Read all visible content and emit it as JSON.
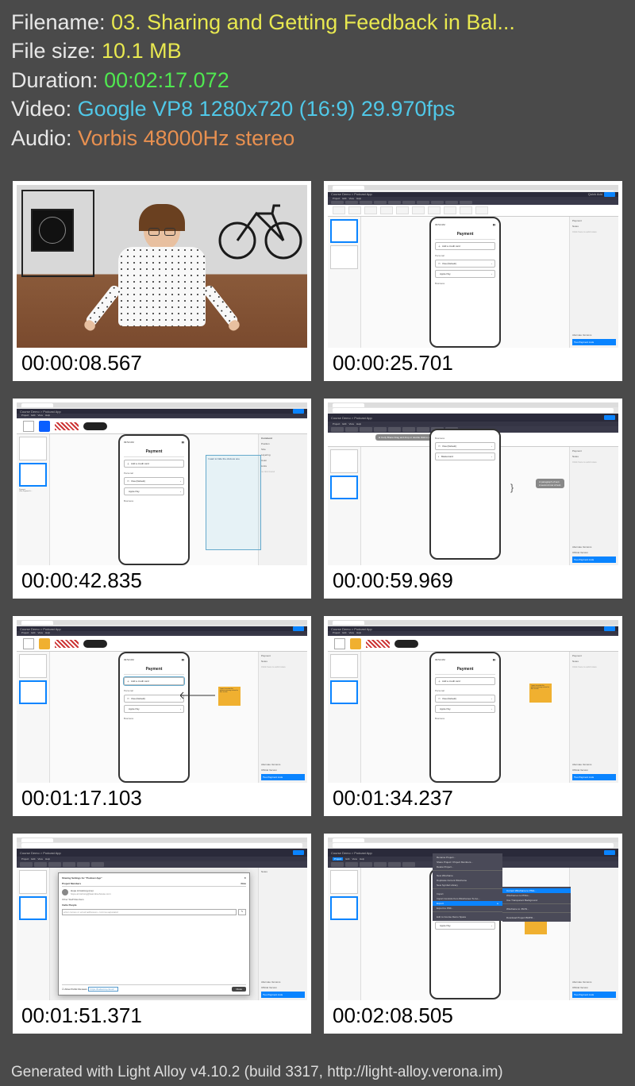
{
  "info": {
    "filename_label": "Filename: ",
    "filename_value": "03. Sharing and Getting Feedback in Bal...",
    "filesize_label": "File size: ",
    "filesize_value": "10.1 MB",
    "duration_label": "Duration: ",
    "duration_value": "00:02:17.072",
    "video_label": "Video: ",
    "video_value": "Google VP8 1280x720 (16:9) 29.970fps",
    "audio_label": "Audio: ",
    "audio_value": "Vorbis 48000Hz stereo"
  },
  "thumbs": {
    "t0": "00:00:08.567",
    "t1": "00:00:25.701",
    "t2": "00:00:42.835",
    "t3": "00:00:59.969",
    "t4": "00:01:17.103",
    "t5": "00:01:34.237",
    "t6": "00:01:51.371",
    "t7": "00:02:08.505"
  },
  "app": {
    "breadcrumb": "Course Demo > Podcast App",
    "menus": {
      "project": "Project",
      "edit": "Edit",
      "view": "View",
      "help": "Help"
    },
    "quickadd": "Quick Add",
    "share": "Share",
    "wireframes": "Wireframes",
    "phone": {
      "time": "09:52 AM",
      "title": "Payment",
      "add_card": "Add a credit card",
      "personal": "Personal",
      "visa": "Visa (Default)",
      "apple": "Apple Pay",
      "mastercard": "Mastercard",
      "business": "Business"
    },
    "right": {
      "payment": "Payment",
      "notes": "Notes",
      "notes_hint": "Click here to add notes",
      "altver": "Alternate Versions",
      "official": "Official Version",
      "twopay": "Two Payment Lists",
      "position": "Position",
      "size": "Size",
      "layering": "Layering",
      "color": "Color",
      "links": "Links",
      "nolink": "no link found"
    },
    "notes": {
      "comment1": "I want to hide the obvious one",
      "sticky1": "I want to make this obvious primary action for this screen",
      "callout1": "H Curly Brace\nDrag and drop or double click to add",
      "callout2": "A paragraph of text.\nA second row of text."
    },
    "dialog": {
      "title": "Sharing Settings for \"Podcast App\"",
      "members": "Project Members",
      "role": "Role",
      "name1": "Hope Armstrong (me)",
      "email1": "hope.armstrong@teamtreehouse.com",
      "other": "Other Staff Members",
      "invite": "Invite People",
      "placeholder": "enter names or email addresses, comma-separated",
      "allow": "Allow Public Reviews",
      "close": "Close"
    },
    "menu": {
      "rename": "Rename Project...",
      "shareproj": "Share Project / Project Members...",
      "delete": "Delete Project...",
      "newwf": "New Wireframe",
      "dup": "Duplicate Current Wireframe",
      "newsym": "New Symbol Library",
      "import": "Import",
      "importctrl": "Import Controls from Wireframes To Go...",
      "export": "Export",
      "exportpdf": "Export to PDF...",
      "editspace": "Edit to Course Demo Space",
      "sub_current": "Current Wireframe to PNG...",
      "sub_all": "Wireframes to PNGs...",
      "sub_bg": "Use Transparent Background",
      "sub_json": "Wireframe to JSON...",
      "sub_bmpr": "Download Project BMPR..."
    }
  },
  "footer": "Generated with Light Alloy v4.10.2 (build 3317, http://light-alloy.verona.im)"
}
